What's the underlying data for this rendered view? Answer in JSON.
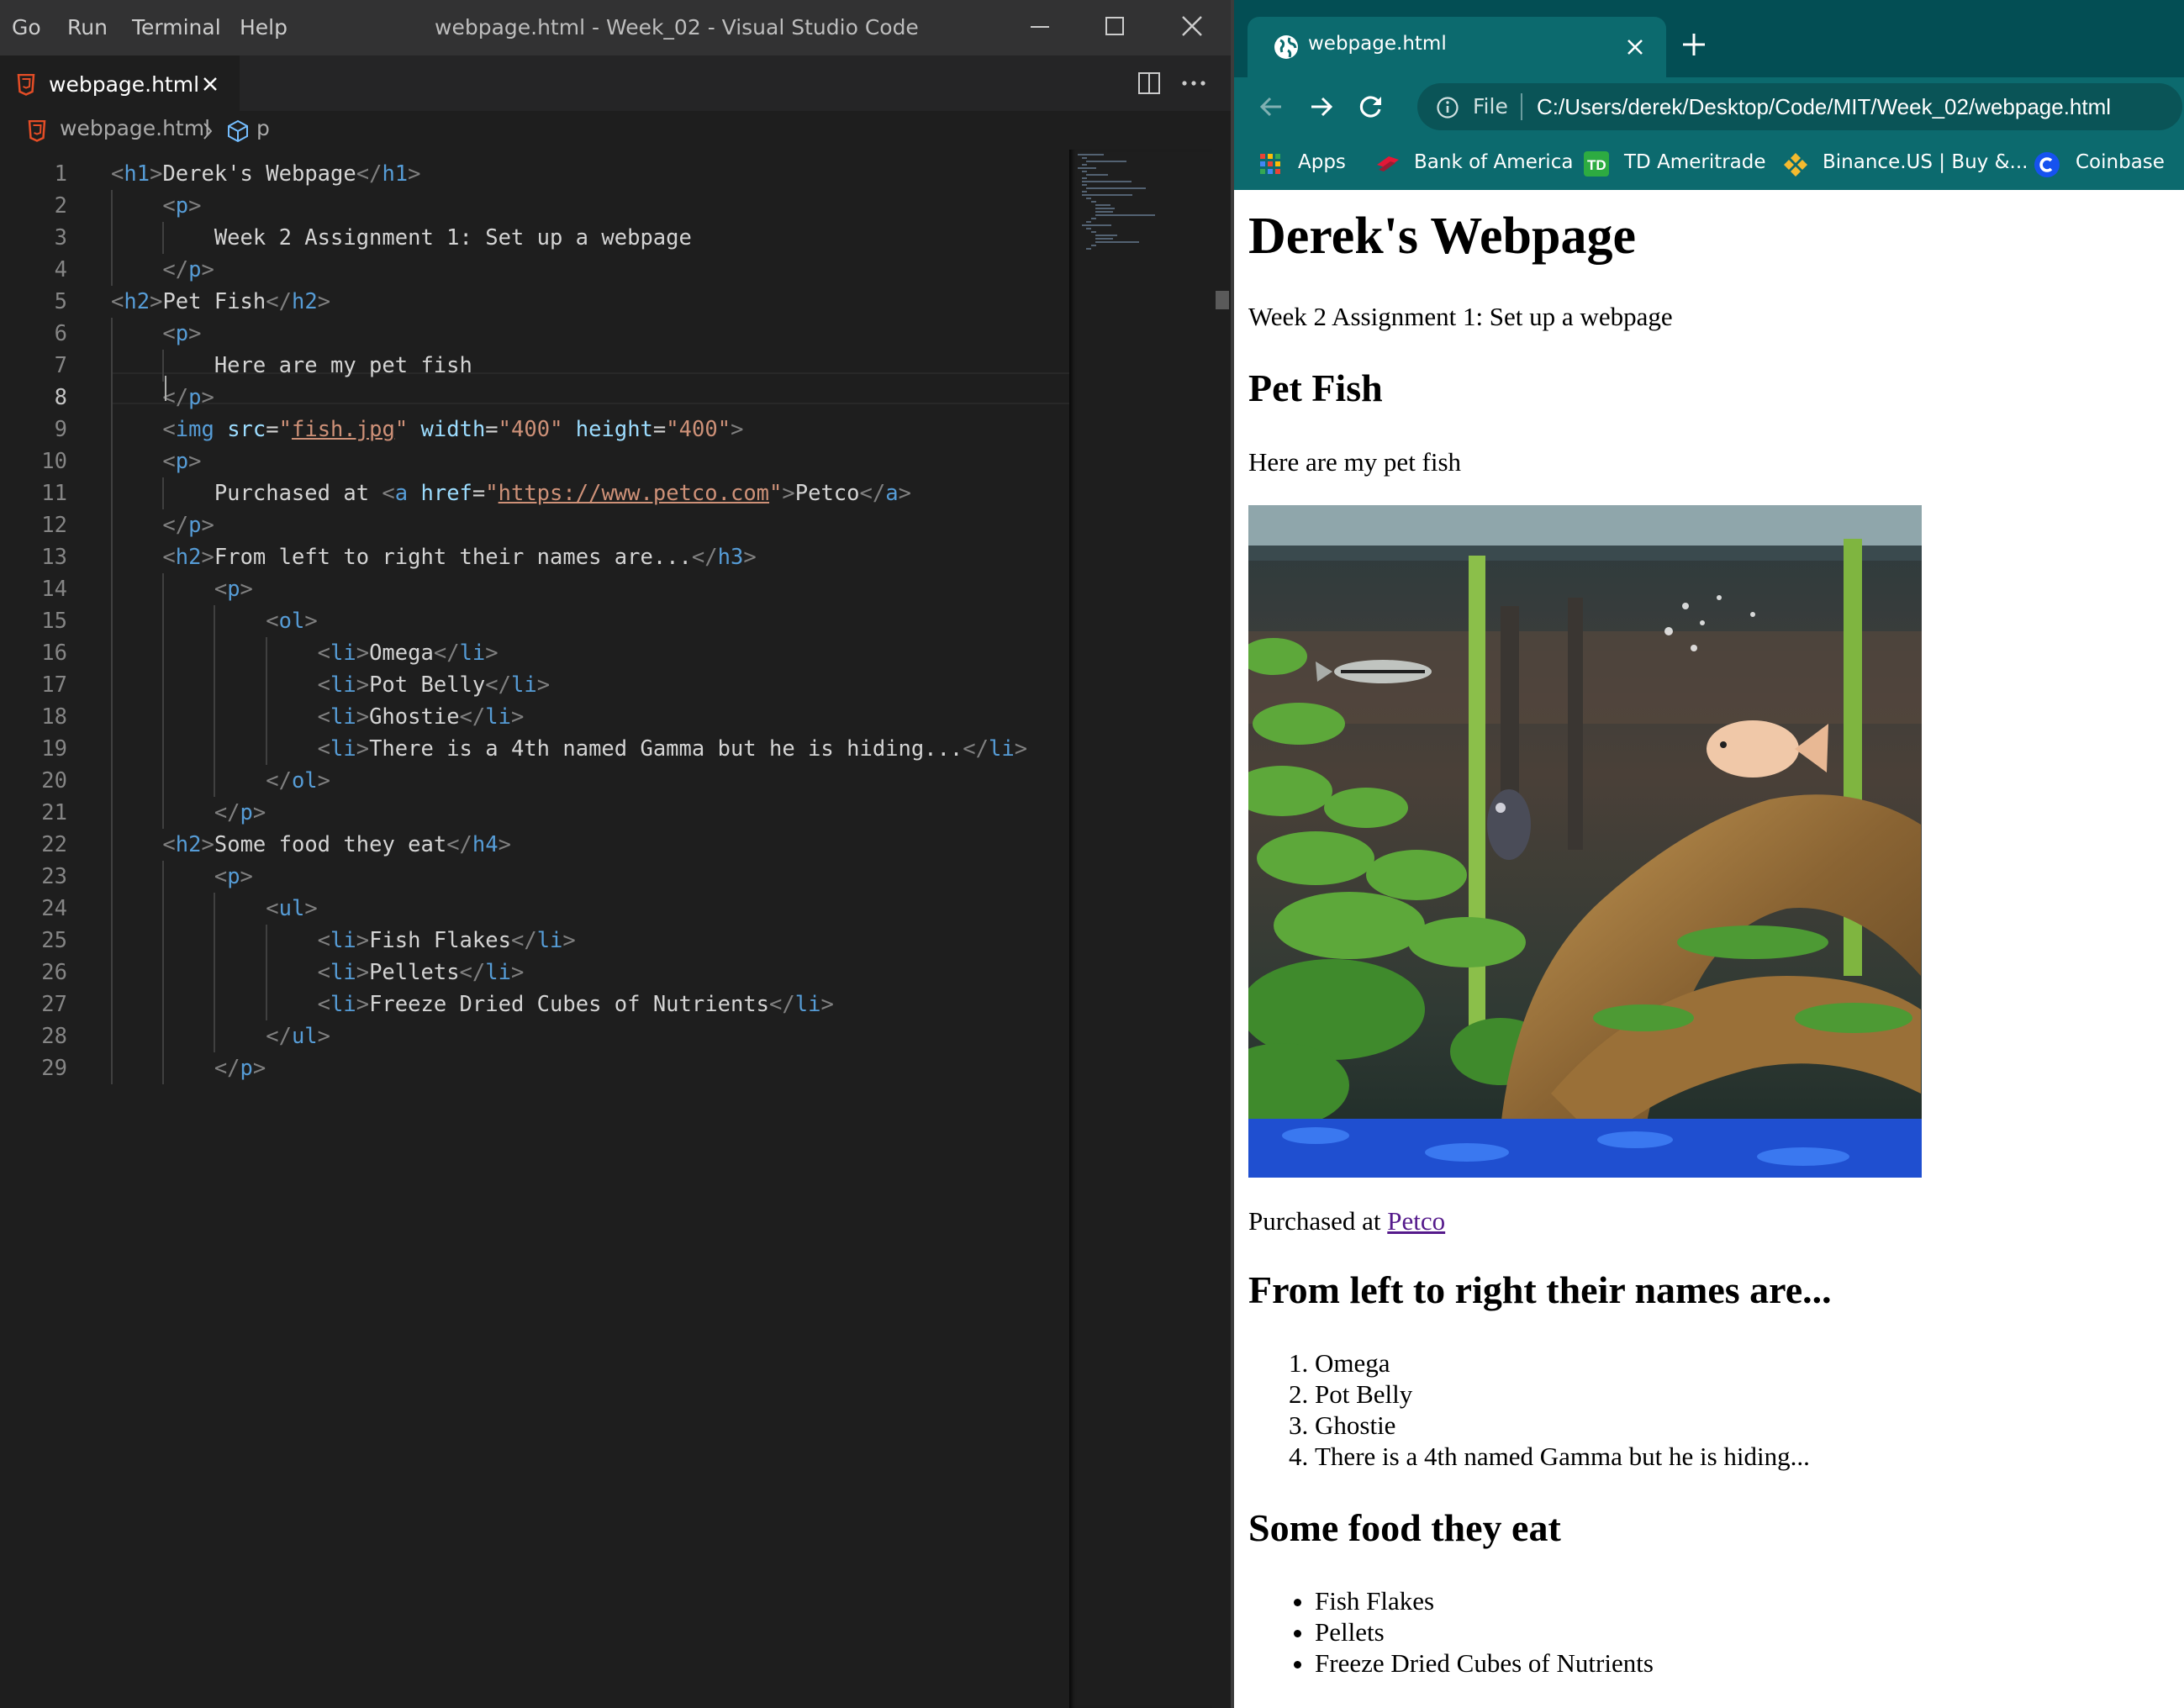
{
  "vscode": {
    "menu": [
      "Go",
      "Run",
      "Terminal",
      "Help"
    ],
    "window_title": "webpage.html - Week_02 - Visual Studio Code",
    "tab_label": "webpage.html",
    "breadcrumb": {
      "file": "webpage.html",
      "symbol": "p"
    },
    "current_line": 8,
    "lines": [
      "<h1>Derek's Webpage</h1>",
      "    <p>",
      "        Week 2 Assignment 1: Set up a webpage",
      "    </p>",
      "<h2>Pet Fish</h2>",
      "    <p>",
      "        Here are my pet fish",
      "    </p>",
      "    <img src=\"fish.jpg\" width=\"400\" height=\"400\">",
      "    <p>",
      "        Purchased at <a href=\"https://www.petco.com\">Petco</a>",
      "    </p>",
      "    <h2>From left to right their names are...</h3>",
      "        <p>",
      "            <ol>",
      "                <li>Omega</li>",
      "                <li>Pot Belly</li>",
      "                <li>Ghostie</li>",
      "                <li>There is a 4th named Gamma but he is hiding...</li>",
      "            </ol>",
      "        </p>",
      "    <h2>Some food they eat</h4>",
      "        <p>",
      "            <ul>",
      "                <li>Fish Flakes</li>",
      "                <li>Pellets</li>",
      "                <li>Freeze Dried Cubes of Nutrients</li>",
      "            </ul>",
      "        </p>"
    ],
    "colors": {
      "tag": "#569cd6",
      "bracket": "#808080",
      "attr": "#9cdcfe",
      "string": "#ce9178",
      "text": "#d4d4d4"
    }
  },
  "chrome": {
    "tab_title": "webpage.html",
    "address_scheme": "File",
    "address_url": "C:/Users/derek/Desktop/Code/MIT/Week_02/webpage.html",
    "bookmarks": [
      "Apps",
      "Bank of America",
      "TD Ameritrade",
      "Binance.US | Buy &...",
      "Coinbase"
    ],
    "page": {
      "h1": "Derek's Webpage",
      "intro": "Week 2 Assignment 1: Set up a webpage",
      "h2_fish": "Pet Fish",
      "fish_text": "Here are my pet fish",
      "purchased_prefix": "Purchased at ",
      "purchased_link": "Petco",
      "h2_names": "From left to right their names are...",
      "names": [
        "Omega",
        "Pot Belly",
        "Ghostie",
        "There is a 4th named Gamma but he is hiding..."
      ],
      "h2_food": "Some food they eat",
      "foods": [
        "Fish Flakes",
        "Pellets",
        "Freeze Dried Cubes of Nutrients"
      ]
    }
  }
}
